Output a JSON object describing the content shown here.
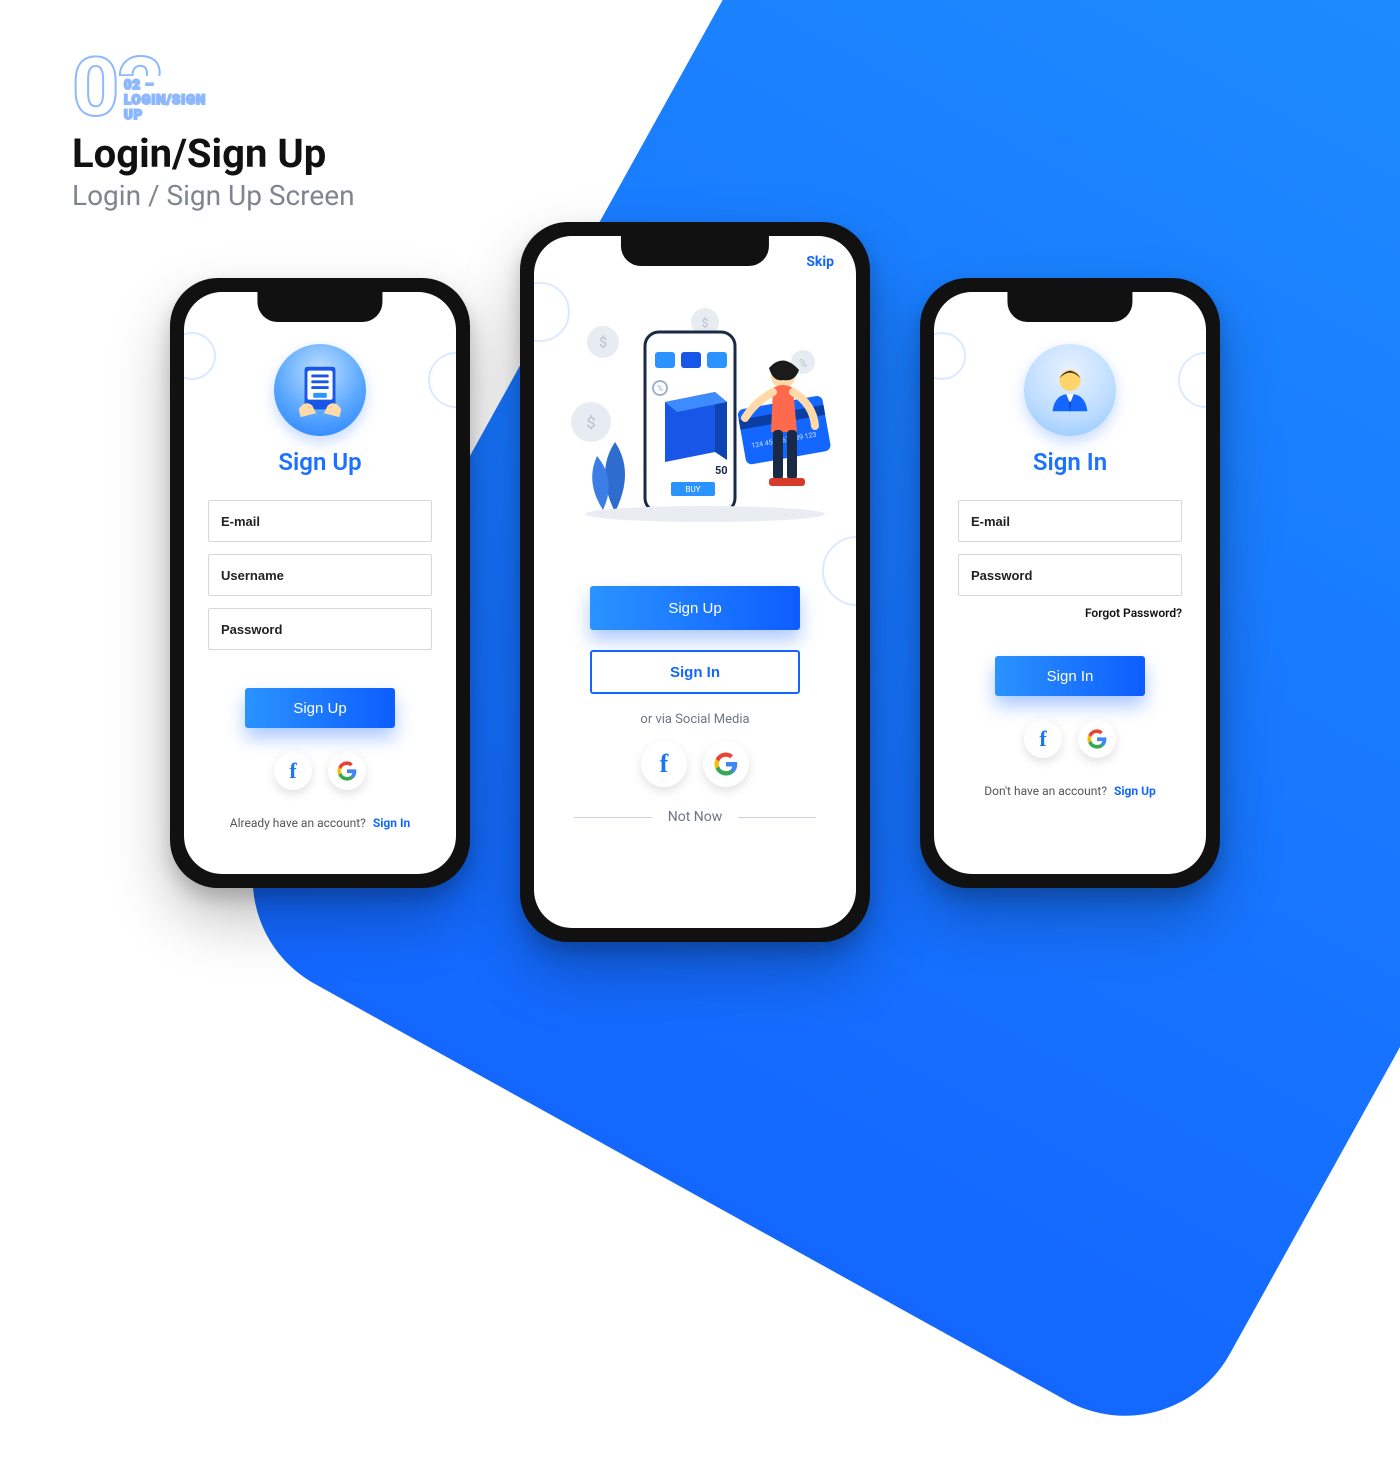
{
  "header": {
    "section_number": "02",
    "section_tag": "02 – LOGIN/SIGN UP",
    "title": "Login/Sign Up",
    "subtitle": "Login / Sign Up Screen"
  },
  "signup": {
    "title": "Sign Up",
    "email_ph": "E-mail",
    "username_ph": "Username",
    "password_ph": "Password",
    "button": "Sign Up",
    "already": "Already have an account?",
    "signin_link": "Sign In"
  },
  "landing": {
    "skip": "Skip",
    "signup_btn": "Sign Up",
    "signin_btn": "Sign In",
    "via": "or via Social Media",
    "notnow": "Not Now",
    "illus_price": "50",
    "illus_buy": "BUY",
    "illus_card_num": "124 456 367 789 123"
  },
  "signin": {
    "title": "Sign In",
    "email_ph": "E-mail",
    "password_ph": "Password",
    "forgot": "Forgot Password?",
    "button": "Sign In",
    "dont": "Don't have an account?",
    "signup_link": "Sign Up"
  },
  "social": {
    "facebook": "facebook",
    "google": "google"
  },
  "colors": {
    "accent": "#1367ff",
    "accent_light": "#2a93ff"
  }
}
